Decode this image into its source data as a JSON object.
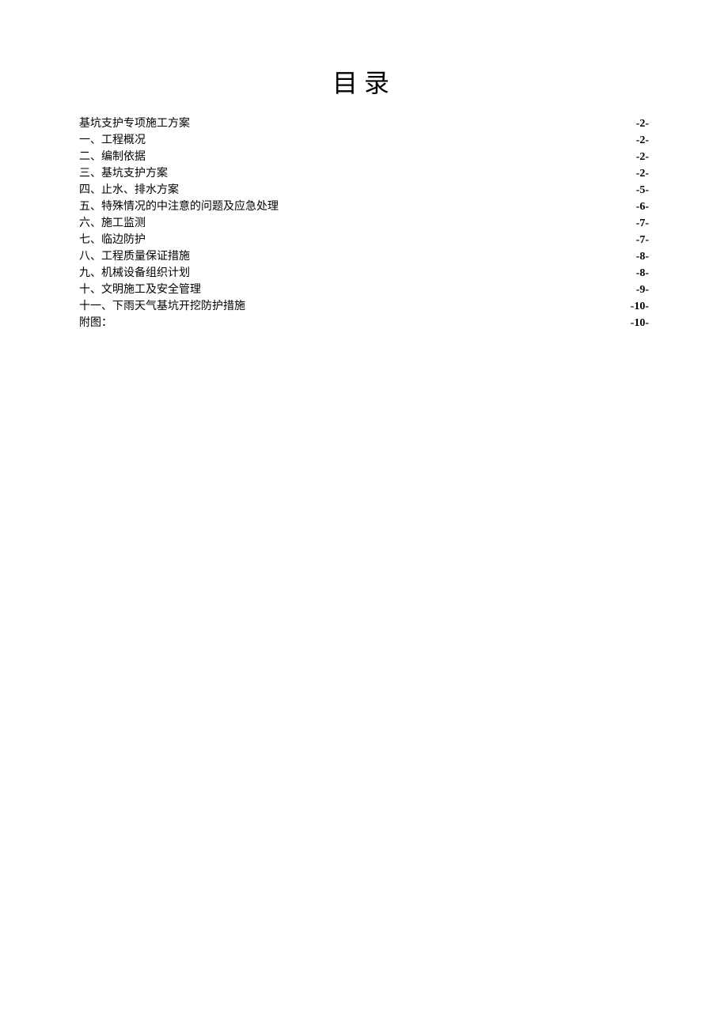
{
  "title": "目录",
  "toc": {
    "entries": [
      {
        "label": "基坑支护专项施工方案",
        "page": "-2-"
      },
      {
        "label": "一、工程概况",
        "page": "-2-"
      },
      {
        "label": "二、编制依据",
        "page": "-2-"
      },
      {
        "label": "三、基坑支护方案",
        "page": "-2-"
      },
      {
        "label": "四、止水、排水方案",
        "page": "-5-"
      },
      {
        "label": "五、特殊情况的中注意的问题及应急处理",
        "page": "-6-"
      },
      {
        "label": "六、施工监测",
        "page": "-7-"
      },
      {
        "label": "七、临边防护",
        "page": "-7-"
      },
      {
        "label": "八、工程质量保证措施",
        "page": "-8-"
      },
      {
        "label": "九、机械设备组织计划",
        "page": "-8-"
      },
      {
        "label": "十、文明施工及安全管理",
        "page": "-9-"
      },
      {
        "label": "十一、下雨天气基坑开挖防护措施",
        "page": "-10-"
      },
      {
        "label": "附图：",
        "page": "-10-"
      }
    ]
  }
}
